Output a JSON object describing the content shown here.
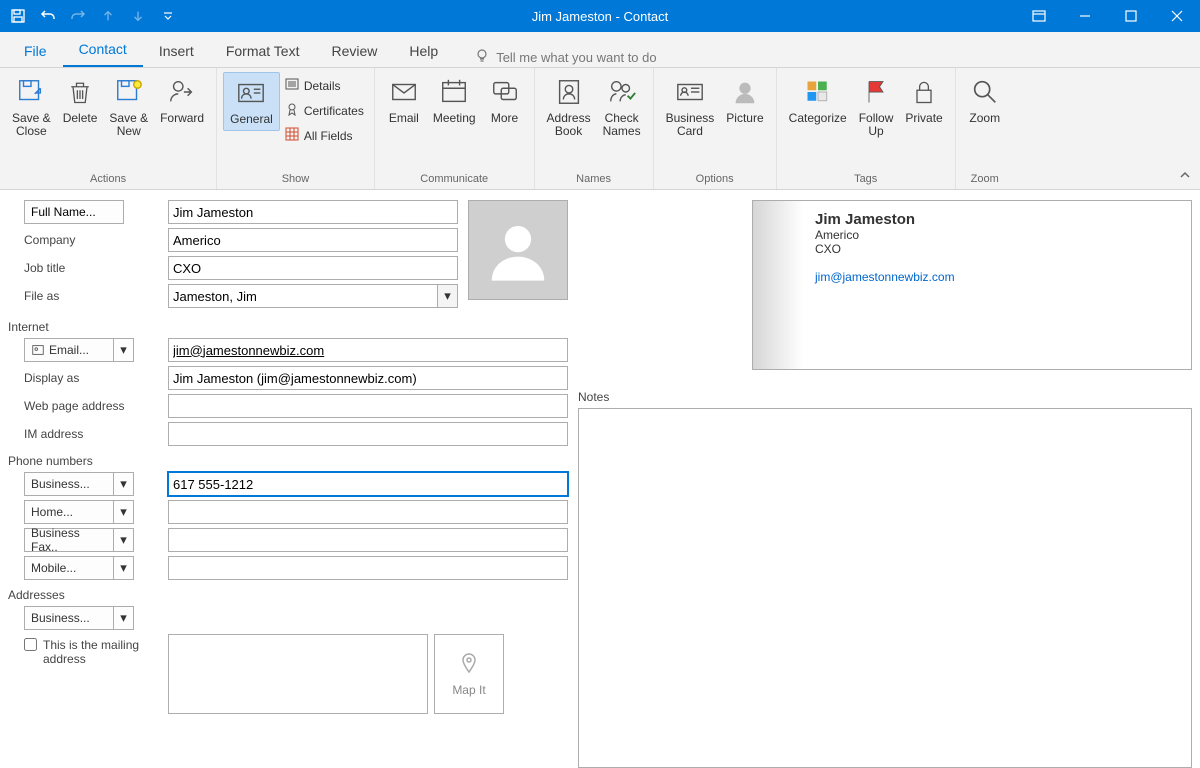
{
  "titlebar": {
    "title": "Jim Jameston  -  Contact"
  },
  "tabs": {
    "file": "File",
    "contact": "Contact",
    "insert": "Insert",
    "formatText": "Format Text",
    "review": "Review",
    "help": "Help",
    "tellme": "Tell me what you want to do"
  },
  "ribbon": {
    "actions": {
      "label": "Actions",
      "saveClose": "Save &\nClose",
      "delete": "Delete",
      "saveNew": "Save &\nNew ",
      "forward": "Forward\n"
    },
    "show": {
      "label": "Show",
      "general": "General",
      "details": "Details",
      "certificates": "Certificates",
      "allFields": "All Fields"
    },
    "communicate": {
      "label": "Communicate",
      "email": "Email",
      "meeting": "Meeting",
      "more": "More\n"
    },
    "names": {
      "label": "Names",
      "addressBook": "Address\nBook",
      "checkNames": "Check\nNames"
    },
    "options": {
      "label": "Options",
      "businessCard": "Business\nCard",
      "picture": "Picture\n"
    },
    "tags": {
      "label": "Tags",
      "categorize": "Categorize\n",
      "followUp": "Follow\nUp ",
      "private": "Private"
    },
    "zoom": {
      "label": "Zoom",
      "zoom": "Zoom"
    }
  },
  "form": {
    "fullNameBtn": "Full Name...",
    "fullName": "Jim Jameston",
    "companyLbl": "Company",
    "company": "Americo",
    "jobTitleLbl": "Job title",
    "jobTitle": "CXO",
    "fileAsLbl": "File as",
    "fileAs": "Jameston, Jim",
    "internetHdr": "Internet",
    "emailBtn": "Email...",
    "email": "jim@jamestonnewbiz.com",
    "displayAsLbl": "Display as",
    "displayAs": "Jim Jameston (jim@jamestonnewbiz.com)",
    "webLbl": "Web page address",
    "web": "",
    "imLbl": "IM address",
    "im": "",
    "phoneHdr": "Phone numbers",
    "businessBtn": "Business...",
    "businessPhone": "617 555-1212",
    "homeBtn": "Home...",
    "homePhone": "",
    "faxBtn": "Business Fax..",
    "faxPhone": "",
    "mobileBtn": "Mobile...",
    "mobilePhone": "",
    "addrHdr": "Addresses",
    "addrBusinessBtn": "Business...",
    "mailingChk": "This is the mailing address",
    "mapIt": "Map It"
  },
  "card": {
    "name": "Jim Jameston",
    "company": "Americo",
    "title": "CXO",
    "email": "jim@jamestonnewbiz.com"
  },
  "notes": {
    "label": "Notes"
  }
}
